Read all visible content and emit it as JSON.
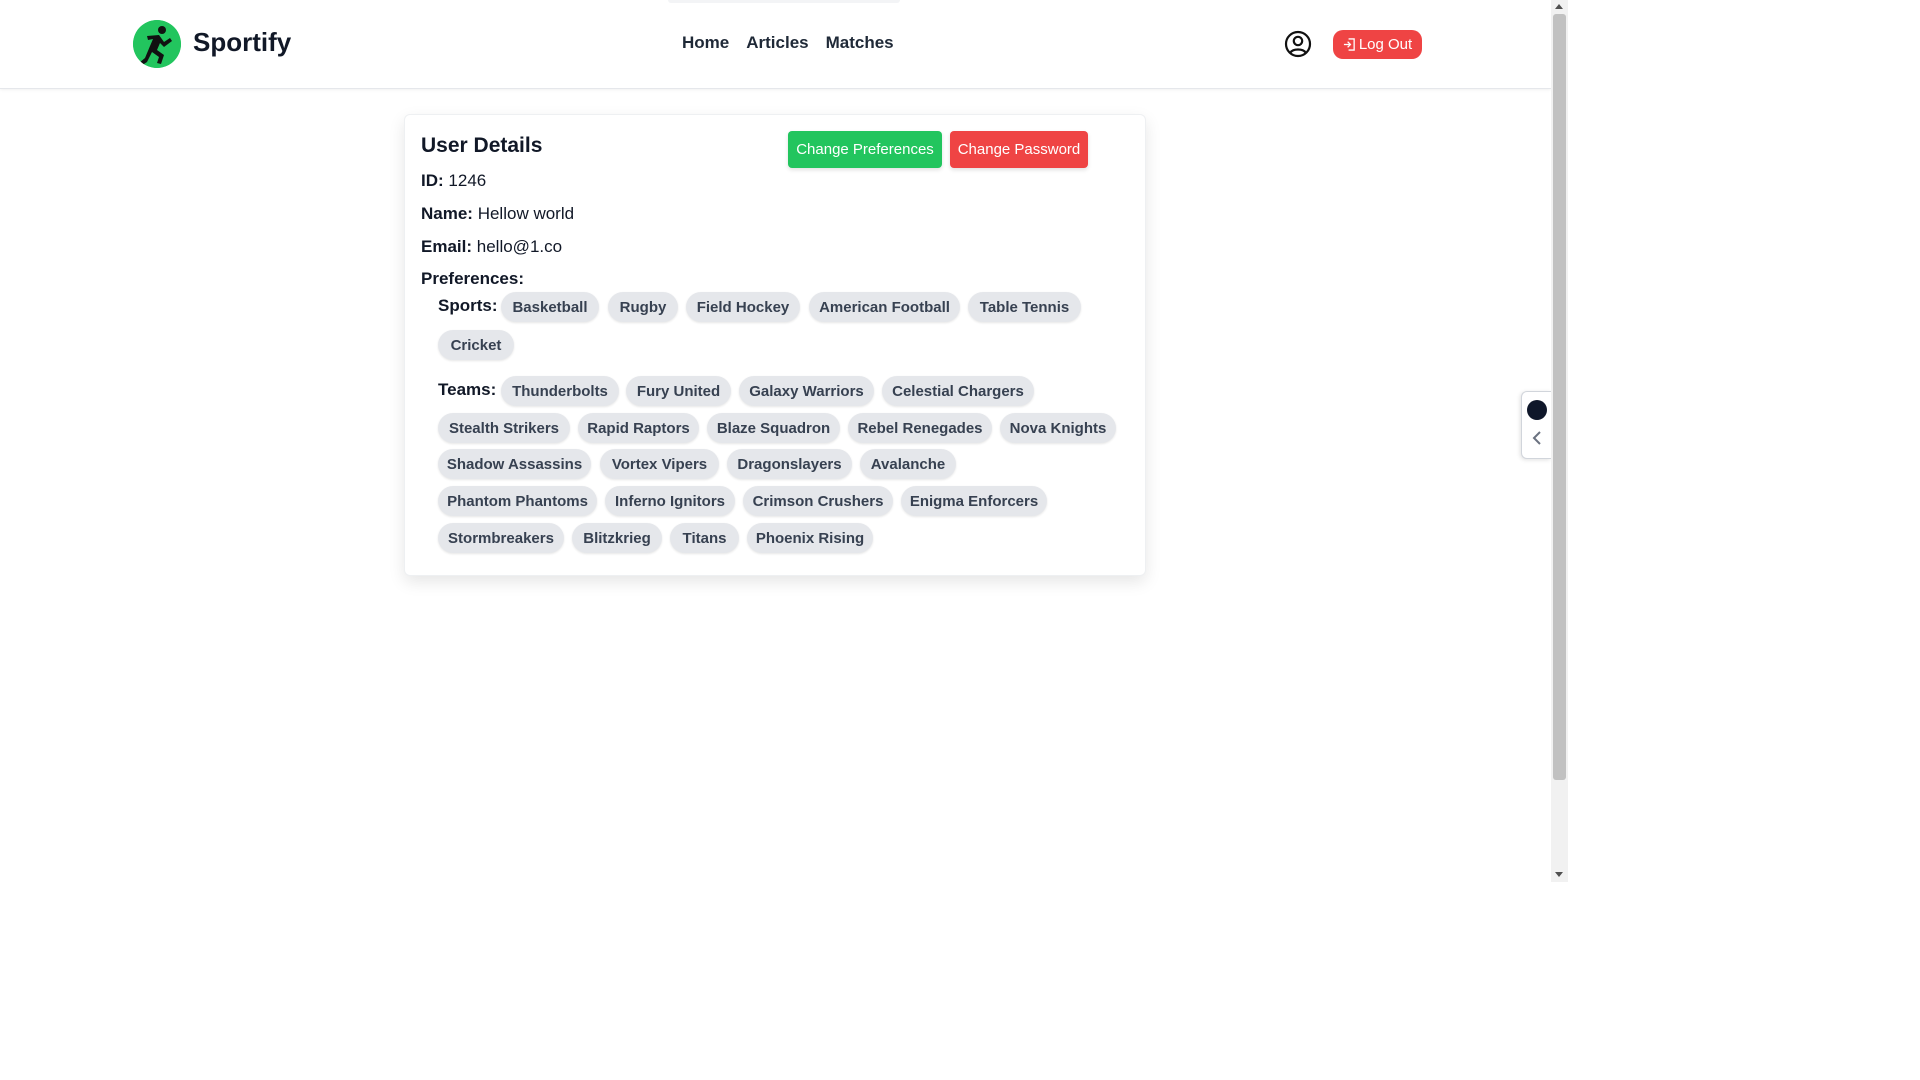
{
  "header": {
    "brand": "Sportify",
    "nav": [
      "Home",
      "Articles",
      "Matches"
    ],
    "logout_label": "Log Out",
    "accent_color": "#22c55e",
    "danger_color": "#ef4444"
  },
  "card": {
    "title": "User Details",
    "change_preferences_label": "Change Preferences",
    "change_password_label": "Change Password",
    "id_label": "ID:",
    "id_value": "1246",
    "name_label": "Name:",
    "name_value": "Hellow world",
    "email_label": "Email:",
    "email_value": "hello@1.co",
    "preferences_label": "Preferences:",
    "sports_label": "Sports:",
    "teams_label": "Teams:",
    "sports": [
      "Basketball",
      "Rugby",
      "Field Hockey",
      "American Football",
      "Table Tennis",
      "Cricket"
    ],
    "teams": [
      "Thunderbolts",
      "Fury United",
      "Galaxy Warriors",
      "Celestial Chargers",
      "Stealth Strikers",
      "Rapid Raptors",
      "Blaze Squadron",
      "Rebel Renegades",
      "Nova Knights",
      "Shadow Assassins",
      "Vortex Vipers",
      "Dragonslayers",
      "Avalanche",
      "Phantom Phantoms",
      "Inferno Ignitors",
      "Crimson Crushers",
      "Enigma Enforcers",
      "Stormbreakers",
      "Blitzkrieg",
      "Titans",
      "Phoenix Rising"
    ]
  },
  "icons": {
    "logo": "runner-logo-icon",
    "user": "user-circle-icon",
    "logout": "logout-icon",
    "side_widget": "chevron-left-icon"
  }
}
